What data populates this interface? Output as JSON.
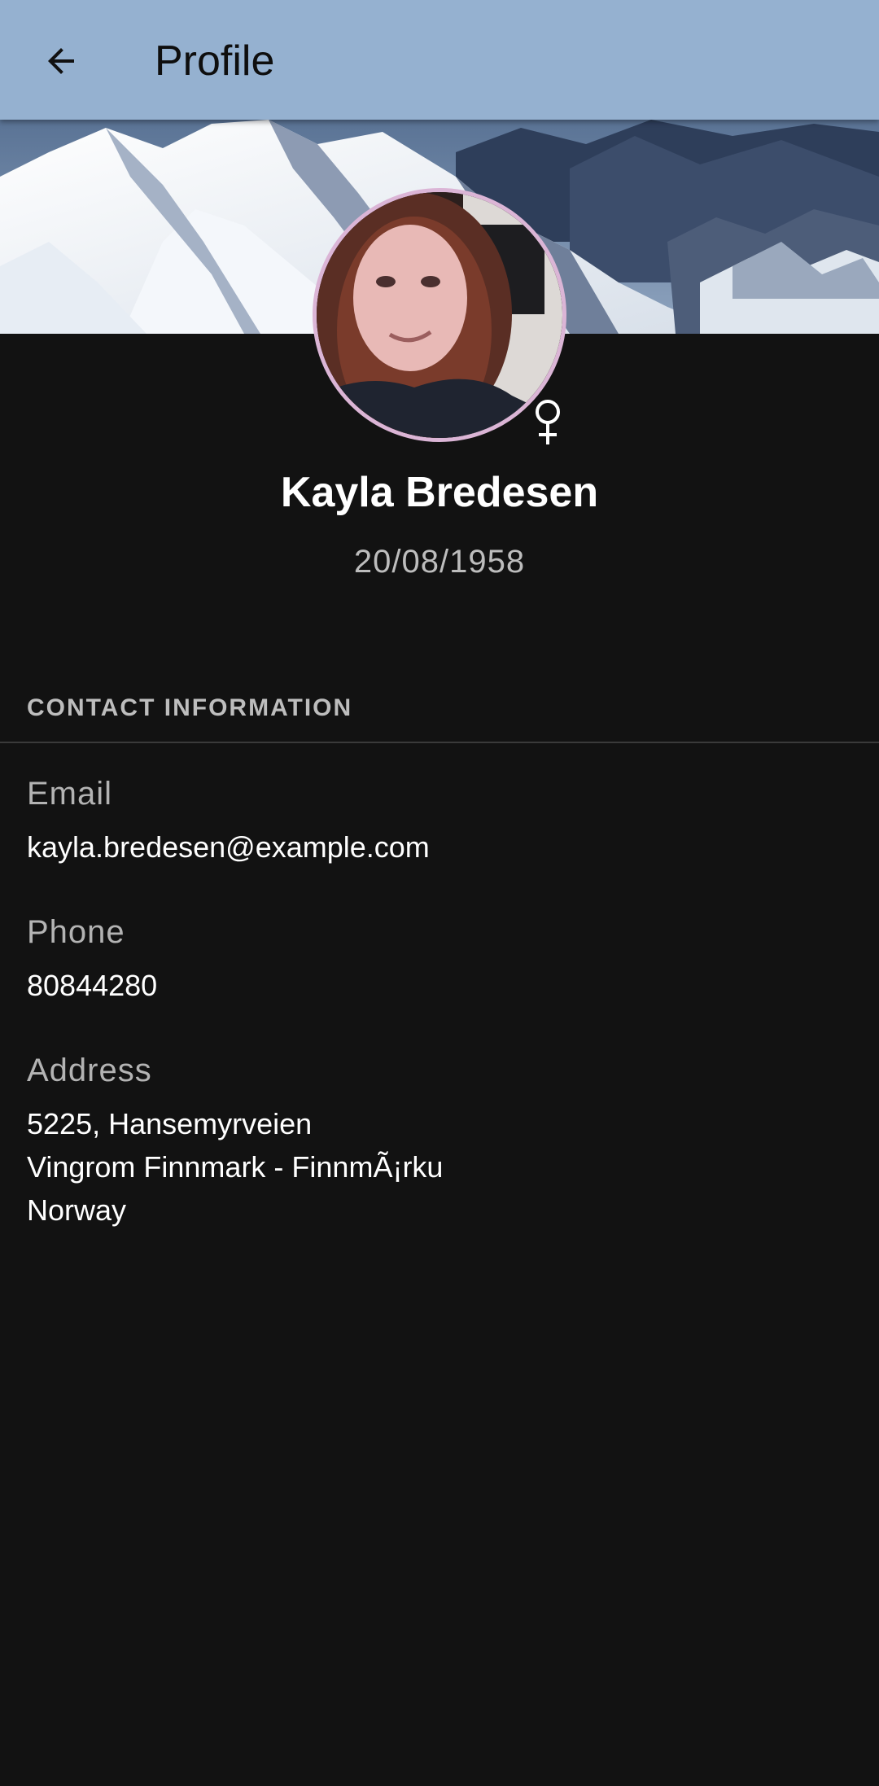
{
  "app_bar": {
    "title": "Profile",
    "back_icon": "arrow-back-icon",
    "background_color": "#95b1d0"
  },
  "profile": {
    "cover_image": "snowy-mountains",
    "avatar_image": "user-photo",
    "avatar_border_color": "#dbb5d6",
    "gender_icon": "female-symbol-icon",
    "name": "Kayla Bredesen",
    "date_of_birth": "20/08/1958"
  },
  "contact": {
    "section_title": "CONTACT INFORMATION",
    "email_label": "Email",
    "email_value": "kayla.bredesen@example.com",
    "phone_label": "Phone",
    "phone_value": "80844280",
    "address_label": "Address",
    "address_line1": "5225, Hansemyrveien",
    "address_line2": "Vingrom Finnmark - FinnmÃ¡rku",
    "address_line3": "Norway"
  },
  "colors": {
    "background": "#121212",
    "label_gray": "#b3b3b3",
    "value_white": "#ffffff"
  }
}
